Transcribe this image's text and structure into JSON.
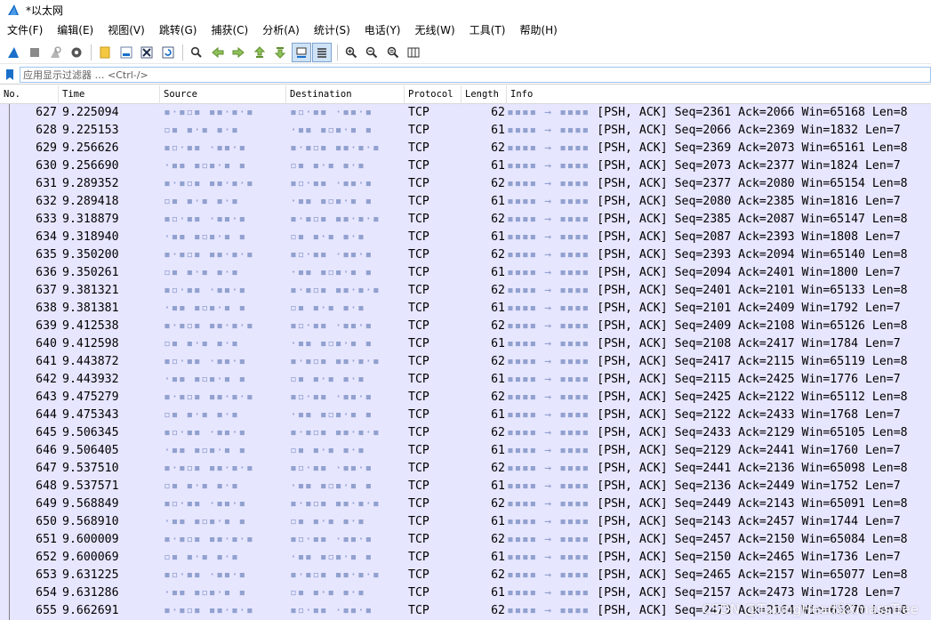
{
  "window": {
    "title": "*以太网"
  },
  "menu": [
    "文件(F)",
    "编辑(E)",
    "视图(V)",
    "跳转(G)",
    "捕获(C)",
    "分析(A)",
    "统计(S)",
    "电话(Y)",
    "无线(W)",
    "工具(T)",
    "帮助(H)"
  ],
  "toolbar": {
    "icons": [
      "shark-fin-start-icon",
      "stop-square-icon",
      "restart-fin-icon",
      "capture-options-gear-icon",
      "open-folder-icon",
      "save-file-icon",
      "close-file-icon",
      "reload-file-icon",
      "find-packet-icon",
      "go-back-arrow-icon",
      "go-forward-arrow-icon",
      "go-to-packet-icon",
      "go-first-packet-icon",
      "go-last-packet-icon",
      "auto-scroll-icon",
      "colorize-list-icon",
      "zoom-in-icon",
      "zoom-out-icon",
      "zoom-normal-icon",
      "resize-columns-icon"
    ]
  },
  "filter": {
    "placeholder": "应用显示过滤器 … <Ctrl-/>"
  },
  "columns": {
    "no": "No.",
    "time": "Time",
    "source": "Source",
    "destination": "Destination",
    "protocol": "Protocol",
    "length": "Length",
    "info": "Info"
  },
  "packets": [
    {
      "no": "627",
      "time": "9.225094",
      "protocol": "TCP",
      "length": "62",
      "info": "[PSH, ACK] Seq=2361 Ack=2066 Win=65168 Len=8"
    },
    {
      "no": "628",
      "time": "9.225153",
      "protocol": "TCP",
      "length": "61",
      "info": "[PSH, ACK] Seq=2066 Ack=2369 Win=1832 Len=7"
    },
    {
      "no": "629",
      "time": "9.256626",
      "protocol": "TCP",
      "length": "62",
      "info": "[PSH, ACK] Seq=2369 Ack=2073 Win=65161 Len=8"
    },
    {
      "no": "630",
      "time": "9.256690",
      "protocol": "TCP",
      "length": "61",
      "info": "[PSH, ACK] Seq=2073 Ack=2377 Win=1824 Len=7"
    },
    {
      "no": "631",
      "time": "9.289352",
      "protocol": "TCP",
      "length": "62",
      "info": "[PSH, ACK] Seq=2377 Ack=2080 Win=65154 Len=8"
    },
    {
      "no": "632",
      "time": "9.289418",
      "protocol": "TCP",
      "length": "61",
      "info": "[PSH, ACK] Seq=2080 Ack=2385 Win=1816 Len=7"
    },
    {
      "no": "633",
      "time": "9.318879",
      "protocol": "TCP",
      "length": "62",
      "info": "[PSH, ACK] Seq=2385 Ack=2087 Win=65147 Len=8"
    },
    {
      "no": "634",
      "time": "9.318940",
      "protocol": "TCP",
      "length": "61",
      "info": "[PSH, ACK] Seq=2087 Ack=2393 Win=1808 Len=7"
    },
    {
      "no": "635",
      "time": "9.350200",
      "protocol": "TCP",
      "length": "62",
      "info": "[PSH, ACK] Seq=2393 Ack=2094 Win=65140 Len=8"
    },
    {
      "no": "636",
      "time": "9.350261",
      "protocol": "TCP",
      "length": "61",
      "info": "[PSH, ACK] Seq=2094 Ack=2401 Win=1800 Len=7"
    },
    {
      "no": "637",
      "time": "9.381321",
      "protocol": "TCP",
      "length": "62",
      "info": "[PSH, ACK] Seq=2401 Ack=2101 Win=65133 Len=8"
    },
    {
      "no": "638",
      "time": "9.381381",
      "protocol": "TCP",
      "length": "61",
      "info": "[PSH, ACK] Seq=2101 Ack=2409 Win=1792 Len=7"
    },
    {
      "no": "639",
      "time": "9.412538",
      "protocol": "TCP",
      "length": "62",
      "info": "[PSH, ACK] Seq=2409 Ack=2108 Win=65126 Len=8"
    },
    {
      "no": "640",
      "time": "9.412598",
      "protocol": "TCP",
      "length": "61",
      "info": "[PSH, ACK] Seq=2108 Ack=2417 Win=1784 Len=7"
    },
    {
      "no": "641",
      "time": "9.443872",
      "protocol": "TCP",
      "length": "62",
      "info": "[PSH, ACK] Seq=2417 Ack=2115 Win=65119 Len=8"
    },
    {
      "no": "642",
      "time": "9.443932",
      "protocol": "TCP",
      "length": "61",
      "info": "[PSH, ACK] Seq=2115 Ack=2425 Win=1776 Len=7"
    },
    {
      "no": "643",
      "time": "9.475279",
      "protocol": "TCP",
      "length": "62",
      "info": "[PSH, ACK] Seq=2425 Ack=2122 Win=65112 Len=8"
    },
    {
      "no": "644",
      "time": "9.475343",
      "protocol": "TCP",
      "length": "61",
      "info": "[PSH, ACK] Seq=2122 Ack=2433 Win=1768 Len=7"
    },
    {
      "no": "645",
      "time": "9.506345",
      "protocol": "TCP",
      "length": "62",
      "info": "[PSH, ACK] Seq=2433 Ack=2129 Win=65105 Len=8"
    },
    {
      "no": "646",
      "time": "9.506405",
      "protocol": "TCP",
      "length": "61",
      "info": "[PSH, ACK] Seq=2129 Ack=2441 Win=1760 Len=7"
    },
    {
      "no": "647",
      "time": "9.537510",
      "protocol": "TCP",
      "length": "62",
      "info": "[PSH, ACK] Seq=2441 Ack=2136 Win=65098 Len=8"
    },
    {
      "no": "648",
      "time": "9.537571",
      "protocol": "TCP",
      "length": "61",
      "info": "[PSH, ACK] Seq=2136 Ack=2449 Win=1752 Len=7"
    },
    {
      "no": "649",
      "time": "9.568849",
      "protocol": "TCP",
      "length": "62",
      "info": "[PSH, ACK] Seq=2449 Ack=2143 Win=65091 Len=8"
    },
    {
      "no": "650",
      "time": "9.568910",
      "protocol": "TCP",
      "length": "61",
      "info": "[PSH, ACK] Seq=2143 Ack=2457 Win=1744 Len=7"
    },
    {
      "no": "651",
      "time": "9.600009",
      "protocol": "TCP",
      "length": "62",
      "info": "[PSH, ACK] Seq=2457 Ack=2150 Win=65084 Len=8"
    },
    {
      "no": "652",
      "time": "9.600069",
      "protocol": "TCP",
      "length": "61",
      "info": "[PSH, ACK] Seq=2150 Ack=2465 Win=1736 Len=7"
    },
    {
      "no": "653",
      "time": "9.631225",
      "protocol": "TCP",
      "length": "62",
      "info": "[PSH, ACK] Seq=2465 Ack=2157 Win=65077 Len=8"
    },
    {
      "no": "654",
      "time": "9.631286",
      "protocol": "TCP",
      "length": "61",
      "info": "[PSH, ACK] Seq=2157 Ack=2473 Win=1728 Len=7"
    },
    {
      "no": "655",
      "time": "9.662691",
      "protocol": "TCP",
      "length": "62",
      "info": "[PSH, ACK] Seq=2473 Ack=2164 Win=65070 Len=8"
    }
  ],
  "colors": {
    "tcp_row_bg": "#e7e6ff",
    "accent": "#1a6fc9"
  },
  "watermark": "CSDN @TubingHead&XmassTree"
}
